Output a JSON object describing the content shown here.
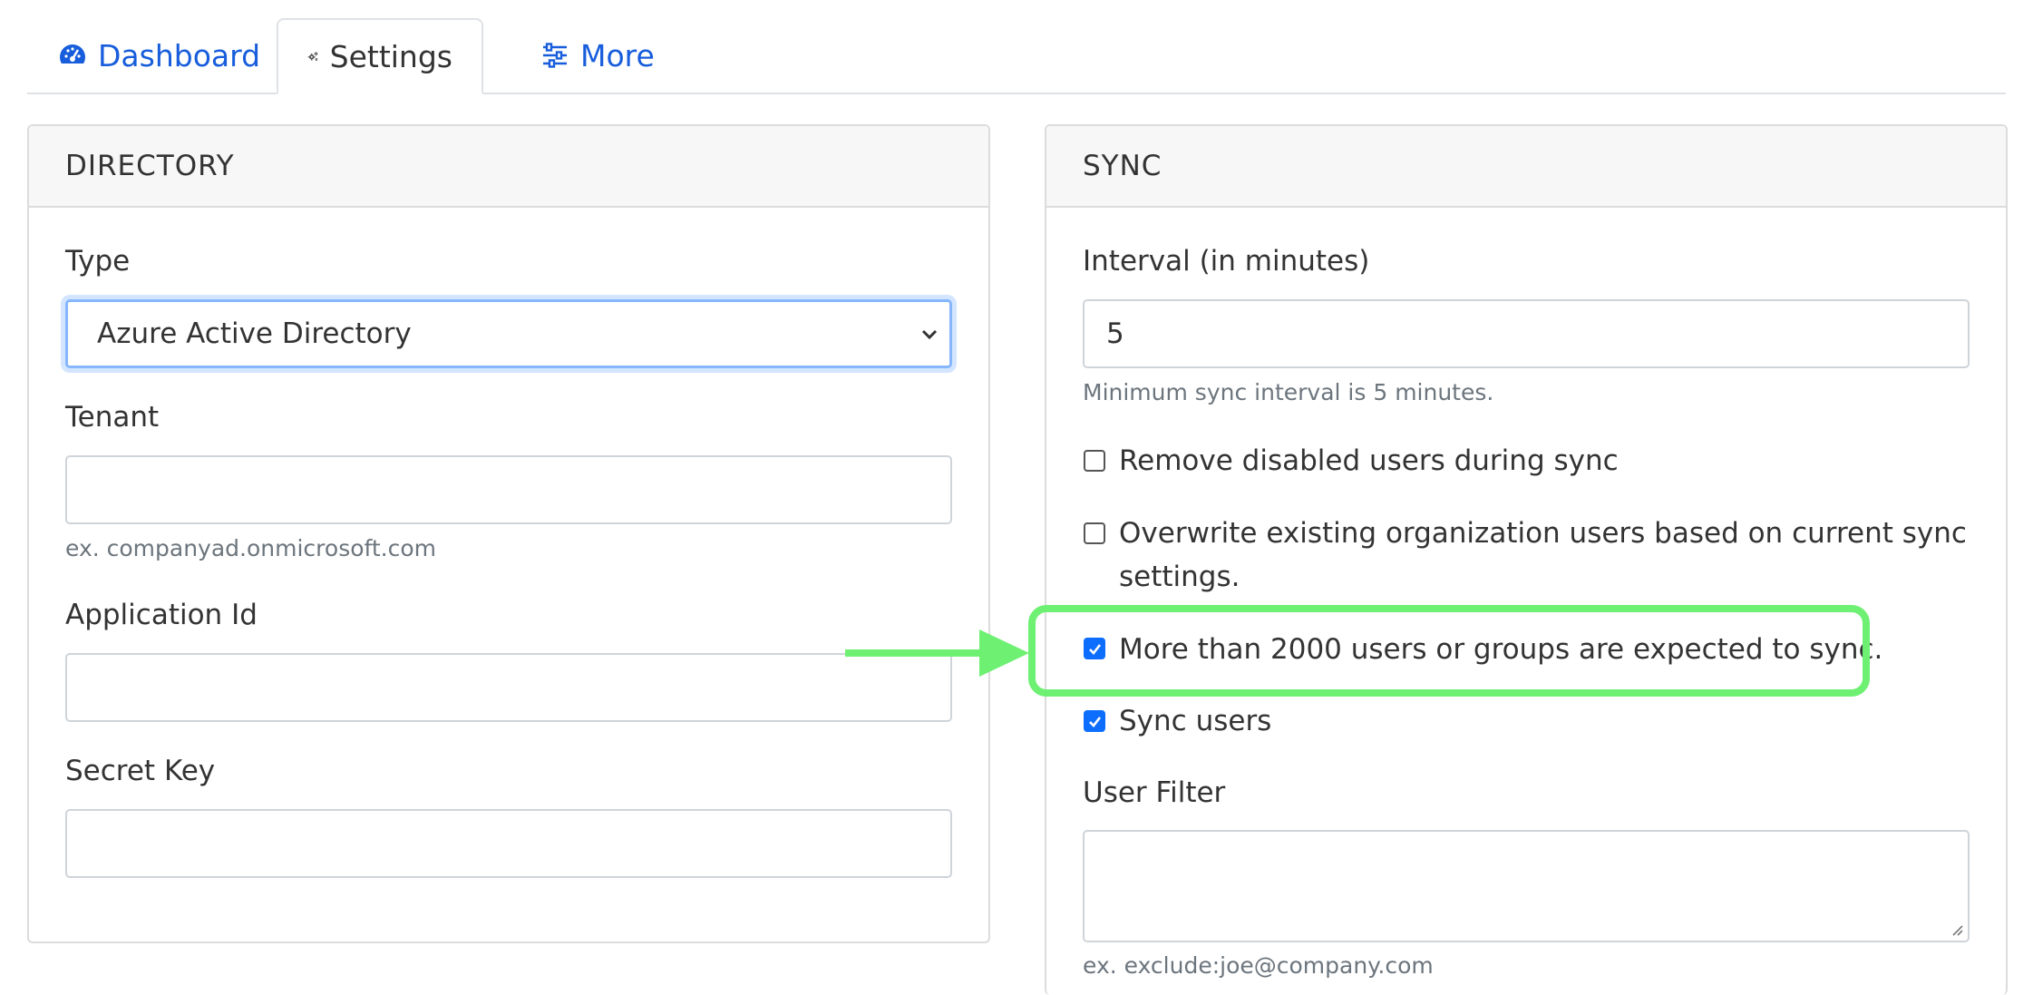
{
  "tabs": [
    {
      "label": "Dashboard",
      "icon": "gauge-icon"
    },
    {
      "label": "Settings",
      "icon": "gears-icon"
    },
    {
      "label": "More",
      "icon": "sliders-icon"
    }
  ],
  "directory": {
    "header": "DIRECTORY",
    "type_label": "Type",
    "type_value": "Azure Active Directory",
    "tenant_label": "Tenant",
    "tenant_value": "",
    "tenant_help": "ex. companyad.onmicrosoft.com",
    "app_id_label": "Application Id",
    "app_id_value": "",
    "secret_label": "Secret Key",
    "secret_value": ""
  },
  "sync": {
    "header": "SYNC",
    "interval_label": "Interval (in minutes)",
    "interval_value": "5",
    "interval_help": "Minimum sync interval is 5 minutes.",
    "remove_disabled": {
      "label": "Remove disabled users during sync",
      "checked": false
    },
    "overwrite": {
      "label_line1": "Overwrite existing organization users based on current sync",
      "label_line2": "settings.",
      "checked": false
    },
    "large_import": {
      "label": "More than 2000 users or groups are expected to sync.",
      "checked": true
    },
    "sync_users": {
      "label": "Sync users",
      "checked": true
    },
    "user_filter_label": "User Filter",
    "user_filter_value": "",
    "user_filter_help": "ex. exclude:joe@company.com"
  },
  "colors": {
    "link": "#175ddc",
    "accent": "#0d6efd",
    "highlight": "#6ef073"
  }
}
